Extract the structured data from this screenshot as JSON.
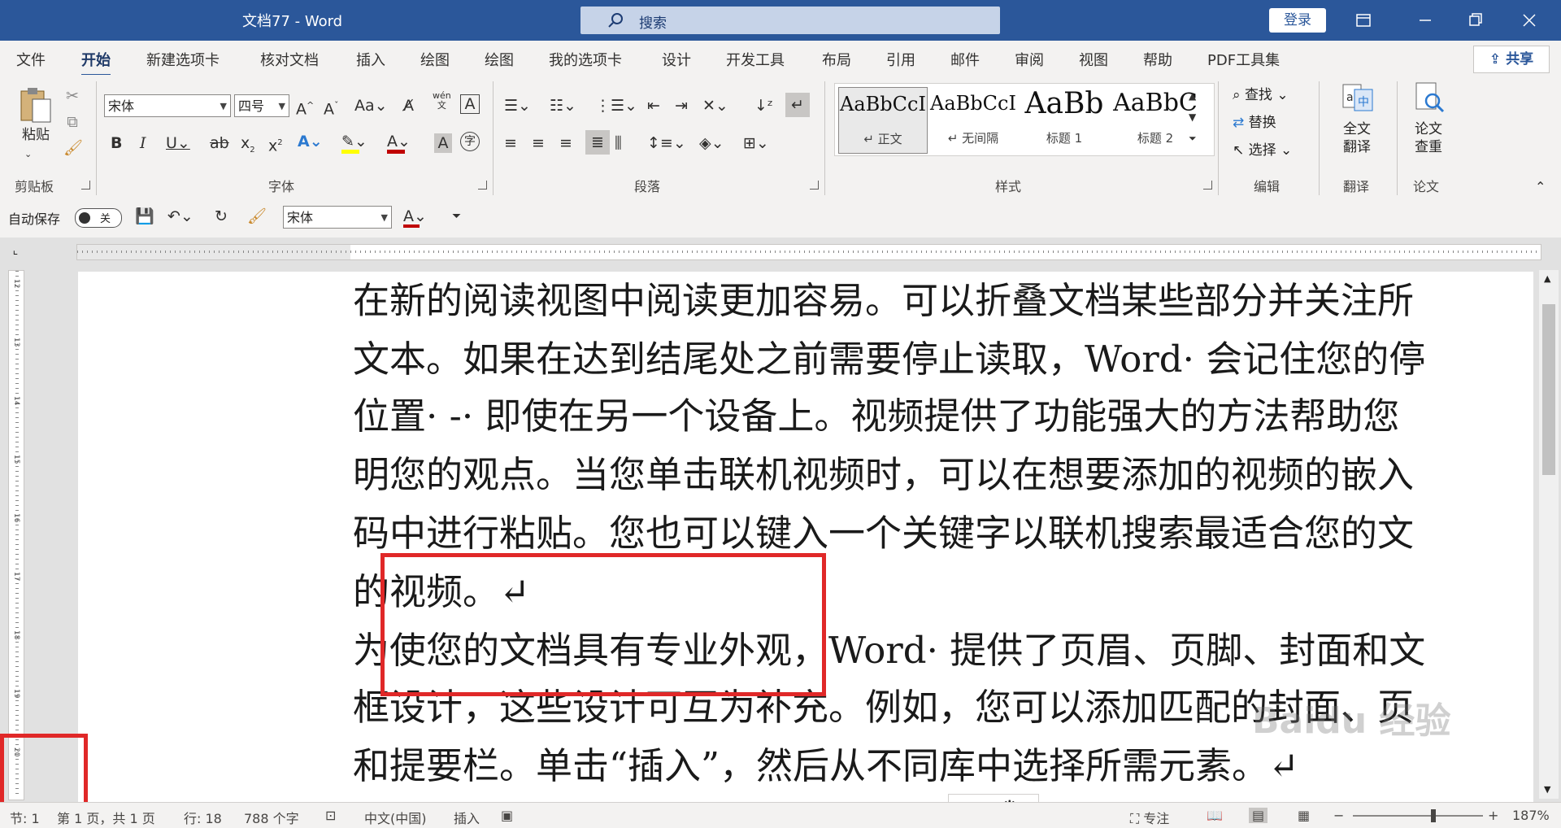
{
  "title_bar": {
    "doc_title": "文档77 - Word",
    "search_label": "搜索",
    "login_label": "登录"
  },
  "menu": {
    "tabs": [
      "文件",
      "开始",
      "新建选项卡",
      "核对文档",
      "插入",
      "绘图",
      "绘图",
      "我的选项卡",
      "设计",
      "开发工具",
      "布局",
      "引用",
      "邮件",
      "审阅",
      "视图",
      "帮助",
      "PDF工具集"
    ],
    "active": "开始",
    "share_label": "共享"
  },
  "ribbon": {
    "clipboard": {
      "paste_label": "粘贴",
      "group_label": "剪贴板"
    },
    "font": {
      "font_name": "宋体",
      "font_size": "四号",
      "group_label": "字体",
      "wen_label": "wén\n文",
      "colors": {
        "highlight": "#ffff00",
        "font": "#c00000"
      }
    },
    "paragraph": {
      "group_label": "段落"
    },
    "styles": {
      "group_label": "样式",
      "items": [
        {
          "sample": "AaBbCcI",
          "name": "↵ 正文"
        },
        {
          "sample": "AaBbCcI",
          "name": "↵ 无间隔"
        },
        {
          "sample": "AaBb",
          "name": "标题 1"
        },
        {
          "sample": "AaBbC",
          "name": "标题 2"
        }
      ]
    },
    "editing": {
      "find_label": "查找",
      "replace_label": "替换",
      "select_label": "选择",
      "group_label": "编辑"
    },
    "translate": {
      "label1": "全文",
      "label2": "翻译",
      "group_label": "翻译"
    },
    "paper": {
      "label1": "论文",
      "label2": "查重",
      "group_label": "论文"
    }
  },
  "qat": {
    "autosave_label": "自动保存",
    "toggle_label": "关",
    "font_name": "宋体"
  },
  "document": {
    "lines": [
      {
        "text": "在新的阅读视图中阅读更加容易。可以折叠文档某些部分并关注所"
      },
      {
        "text": "文本。如果在达到结尾处之前需要停止读取，Word· 会记住您的停"
      },
      {
        "text": "位置· -· 即使在另一个设备上。视频提供了功能强大的方法帮助您"
      },
      {
        "text": "明您的观点。当您单击联机视频时，可以在想要添加的视频的嵌入"
      },
      {
        "text": "码中进行粘贴。您也可以键入一个关键字以联机搜索最适合您的文"
      },
      {
        "text": "的视频。↵"
      },
      {
        "text": "为使您的文档具有专业外观，Word· 提供了页眉、页脚、封面和文"
      },
      {
        "text": "框设计，这些设计可互为补充。例如，您可以添加匹配的封面、页"
      },
      {
        "text": "和提要栏。单击“插入”，然后从不同库中选择所需元素。↵"
      }
    ]
  },
  "vruler_numbers": [
    "12",
    "13",
    "14",
    "15",
    "16",
    "17",
    "18",
    "19",
    "20"
  ],
  "status": {
    "section": "节: 1",
    "page": "第 1 页，共 1 页",
    "row": "行: 18",
    "words": "788 个字",
    "language": "中文(中国)",
    "insert_mode": "插入",
    "focus": "专注",
    "zoom": "187%"
  },
  "ime": {
    "label": "中"
  },
  "watermark": "Baidu 经验",
  "accent_color": "#2b579a"
}
